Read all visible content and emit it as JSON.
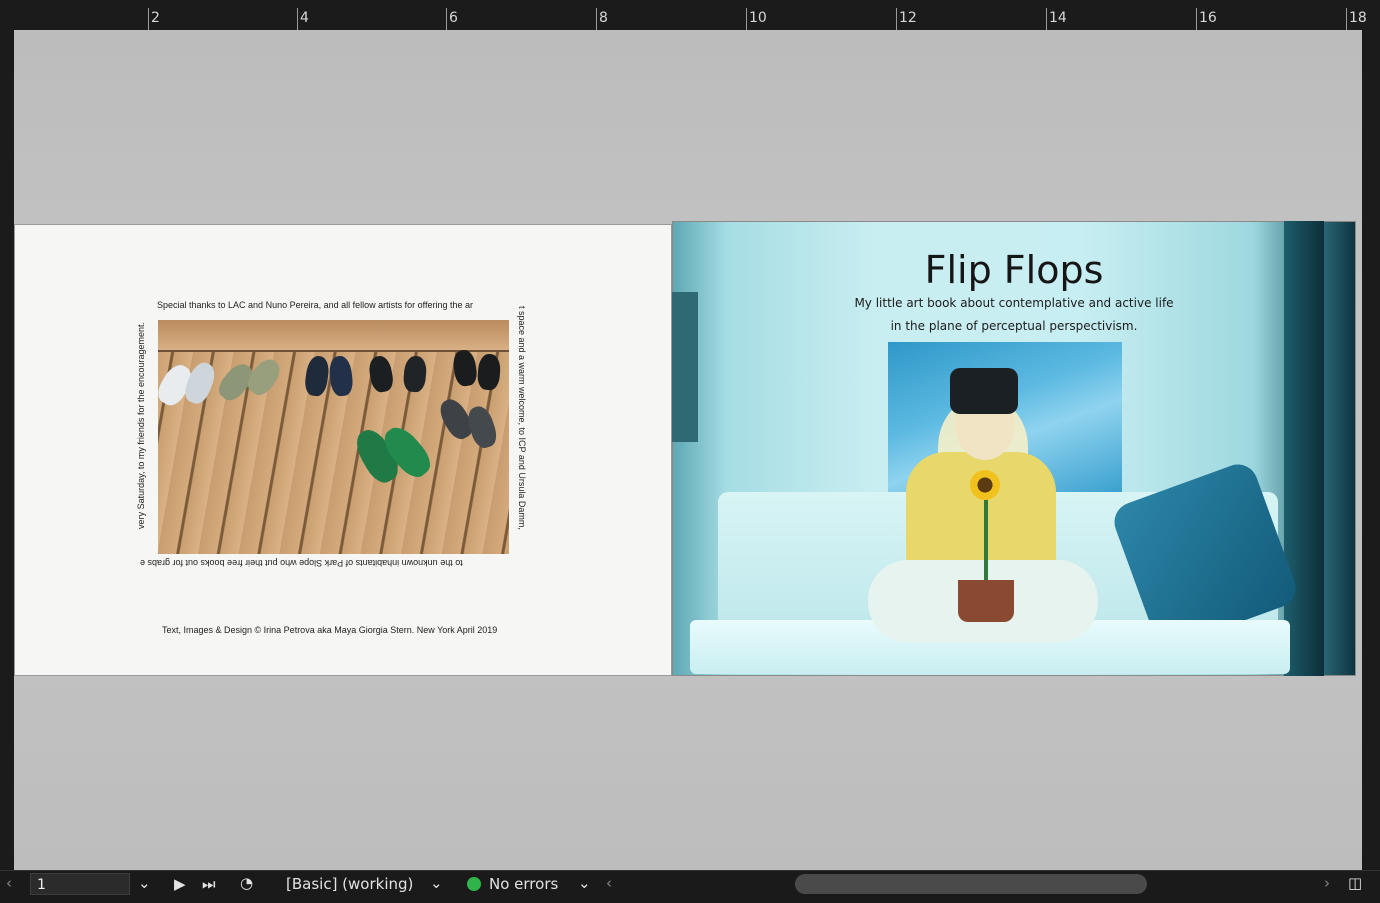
{
  "ruler": {
    "labels": [
      "2",
      "4",
      "6",
      "8",
      "10",
      "12",
      "14",
      "16",
      "18"
    ]
  },
  "left_page": {
    "thanks_top": "Special thanks to LAC and Nuno Pereira, and all fellow artists for offering the ar",
    "thanks_right": "t space and a warm welcome, to ICP and Ursula  Damm,",
    "thanks_bottom": "to the unknown inhabitants of Park Slope who put their free books out for grabs e",
    "thanks_left": "very Saturday, to my friends for the encouragement.",
    "credits": "Text, Images & Design © Irina Petrova aka Maya Giorgia Stern. New York April 2019"
  },
  "right_page": {
    "title": "Flip Flops",
    "subtitle_line1": "My little art book about contemplative and active life",
    "subtitle_line2": "in the plane of perceptual perspectivism."
  },
  "statusbar": {
    "page_number": "1",
    "master": "[Basic] (working)",
    "preflight_status": "No errors"
  }
}
